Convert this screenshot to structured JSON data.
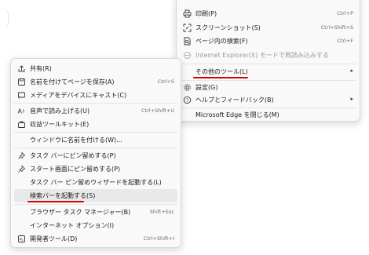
{
  "back_menu": {
    "items": [
      {
        "label": "印刷(P)",
        "shortcut": "Ctrl+P"
      },
      {
        "label": "スクリーンショット(S)",
        "shortcut": "Ctrl+Shift+S"
      },
      {
        "label": "ページ内の検索(F)",
        "shortcut": "Ctrl+F"
      },
      {
        "label": "Internet Explorer(X) モードで再読み込みする",
        "shortcut": ""
      },
      {
        "label": "その他のツール(L)",
        "shortcut": ""
      },
      {
        "label": "設定(G)",
        "shortcut": ""
      },
      {
        "label": "ヘルプとフィードバック(B)",
        "shortcut": ""
      },
      {
        "label": "Microsoft Edge を閉じる(M)",
        "shortcut": ""
      }
    ]
  },
  "front_menu": {
    "items": [
      {
        "label": "共有(R)",
        "shortcut": ""
      },
      {
        "label": "名前を付けてページを保存(A)",
        "shortcut": "Ctrl+S"
      },
      {
        "label": "メディアをデバイスにキャスト(C)",
        "shortcut": ""
      },
      {
        "label": "音声で読み上げる(U)",
        "shortcut": "Ctrl+Shift+U"
      },
      {
        "label": "収益ツールキット(E)",
        "shortcut": ""
      },
      {
        "label": "ウィンドウに名前を付ける(W)...",
        "shortcut": ""
      },
      {
        "label": "タスク バーにピン留めする(P)",
        "shortcut": ""
      },
      {
        "label": "スタート画面にピン留めする(P)",
        "shortcut": ""
      },
      {
        "label": "タスク バー ピン留めウィザードを起動する(L)",
        "shortcut": ""
      },
      {
        "label": "検索バーを起動する(S)",
        "shortcut": ""
      },
      {
        "label": "ブラウザー タスク マネージャー(B)",
        "shortcut": "Shift+Esc"
      },
      {
        "label": "インターネット オプション(I)",
        "shortcut": ""
      },
      {
        "label": "開発者ツール(D)",
        "shortcut": "Ctrl+Shift+I"
      }
    ]
  },
  "colors": {
    "highlight_line": "#d80000",
    "menu_bg": "#f9f9f9",
    "hover_bg": "#e9e9e9"
  },
  "icons": [
    "print-icon",
    "screenshot-icon",
    "find-in-page-icon",
    "ie-mode-icon",
    "settings-icon",
    "help-icon",
    "share-icon",
    "save-page-icon",
    "cast-icon",
    "read-aloud-icon",
    "toolkit-icon",
    "pin-taskbar-icon",
    "pin-start-icon",
    "search-bar-icon",
    "dev-tools-icon"
  ]
}
